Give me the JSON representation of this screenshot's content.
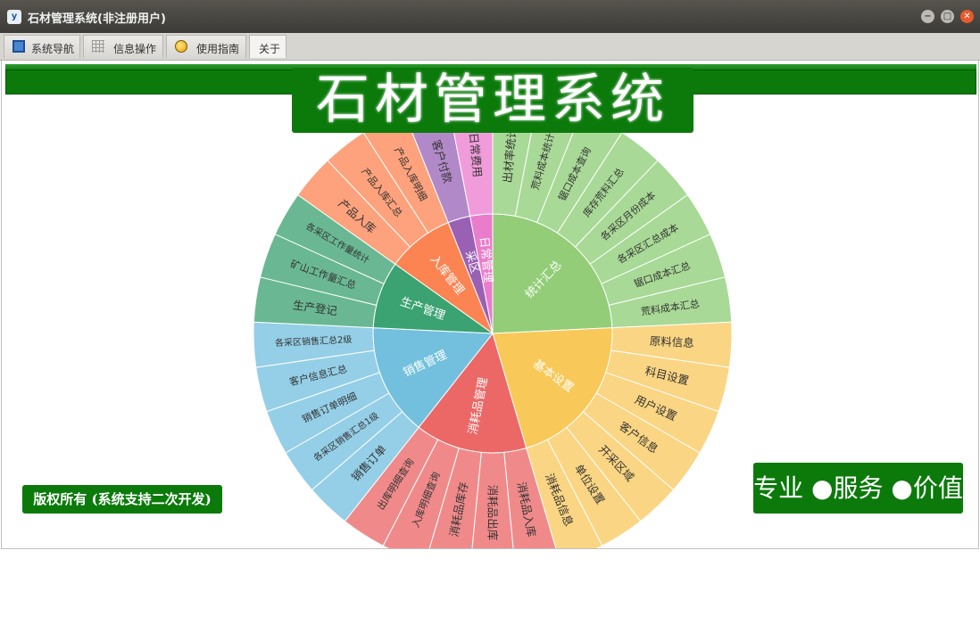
{
  "window": {
    "icon_text": "y",
    "title": "石材管理系统(非注册用户)",
    "minimize": "−",
    "maximize": "□",
    "close": "✕"
  },
  "tabs": [
    {
      "label": "系统导航",
      "icon": "monitor-icon"
    },
    {
      "label": "信息操作",
      "icon": "grid-icon"
    },
    {
      "label": "使用指南",
      "icon": "globe-icon"
    },
    {
      "label": "关于",
      "icon": ""
    }
  ],
  "active_tab": "关于",
  "banner": {
    "title": "石材管理系统"
  },
  "footer": {
    "copyright": "版权所有 (系统支持二次开发)",
    "slogan": "专业 ●服务 ●价值"
  },
  "colors": {
    "brand_green": "#0b7a0b"
  },
  "sunburst": {
    "sectors": [
      {
        "label": "统计汇总",
        "color": "#93cd78",
        "children": [
          {
            "label": "出材率统计",
            "color": "#a8d996"
          },
          {
            "label": "荒料成本统计",
            "color": "#a8d996"
          },
          {
            "label": "锯口成本查询",
            "color": "#a8d996"
          },
          {
            "label": "库存荒料汇总",
            "color": "#a8d996"
          },
          {
            "label": "各采区月份成本",
            "color": "#a8d996"
          },
          {
            "label": "各采区汇总成本",
            "color": "#a8d996"
          },
          {
            "label": "锯口成本汇总",
            "color": "#a8d996"
          },
          {
            "label": "荒料成本汇总",
            "color": "#a8d996"
          }
        ]
      },
      {
        "label": "基本设置",
        "color": "#f8c858",
        "children": [
          {
            "label": "原料信息",
            "color": "#fad583"
          },
          {
            "label": "科目设置",
            "color": "#fad583"
          },
          {
            "label": "用户设置",
            "color": "#fad583"
          },
          {
            "label": "客户信息",
            "color": "#fad583"
          },
          {
            "label": "开采区域",
            "color": "#fad583"
          },
          {
            "label": "单位设置",
            "color": "#fad583"
          },
          {
            "label": "消耗品信息",
            "color": "#fad583"
          }
        ]
      },
      {
        "label": "消耗品管理",
        "color": "#ec6867",
        "children": [
          {
            "label": "消耗品入库",
            "color": "#f08a8a"
          },
          {
            "label": "消耗品出库",
            "color": "#f08a8a"
          },
          {
            "label": "消耗品库存",
            "color": "#f08a8a"
          },
          {
            "label": "入库明细查询",
            "color": "#f08a8a"
          },
          {
            "label": "出库明细查询",
            "color": "#f08a8a"
          }
        ]
      },
      {
        "label": "销售管理",
        "color": "#73c0de",
        "children": [
          {
            "label": "销售订单",
            "color": "#94cfe7"
          },
          {
            "label": "各采区销售汇总1级",
            "color": "#94cfe7"
          },
          {
            "label": "销售订单明细",
            "color": "#94cfe7"
          },
          {
            "label": "客户信息汇总",
            "color": "#94cfe7"
          },
          {
            "label": "各采区销售汇总2级",
            "color": "#94cfe7"
          }
        ]
      },
      {
        "label": "生产管理",
        "color": "#3ba272",
        "children": [
          {
            "label": "生产登记",
            "color": "#6ab893"
          },
          {
            "label": "矿山工作量汇总",
            "color": "#6ab893"
          },
          {
            "label": "各采区工作量统计",
            "color": "#6ab893"
          }
        ]
      },
      {
        "label": "入库管理",
        "color": "#fc8452",
        "children": [
          {
            "label": "产品入库",
            "color": "#fda27c"
          },
          {
            "label": "产品入库汇总",
            "color": "#fda27c"
          },
          {
            "label": "产品入库明细",
            "color": "#fda27c"
          }
        ]
      },
      {
        "label": "采区",
        "color": "#9a60b4",
        "children": [
          {
            "label": "客户付款",
            "color": "#b289c8"
          }
        ]
      },
      {
        "label": "日常管理",
        "color": "#ea7ccc",
        "children": [
          {
            "label": "日常费用",
            "color": "#f09cdb"
          }
        ]
      }
    ]
  }
}
